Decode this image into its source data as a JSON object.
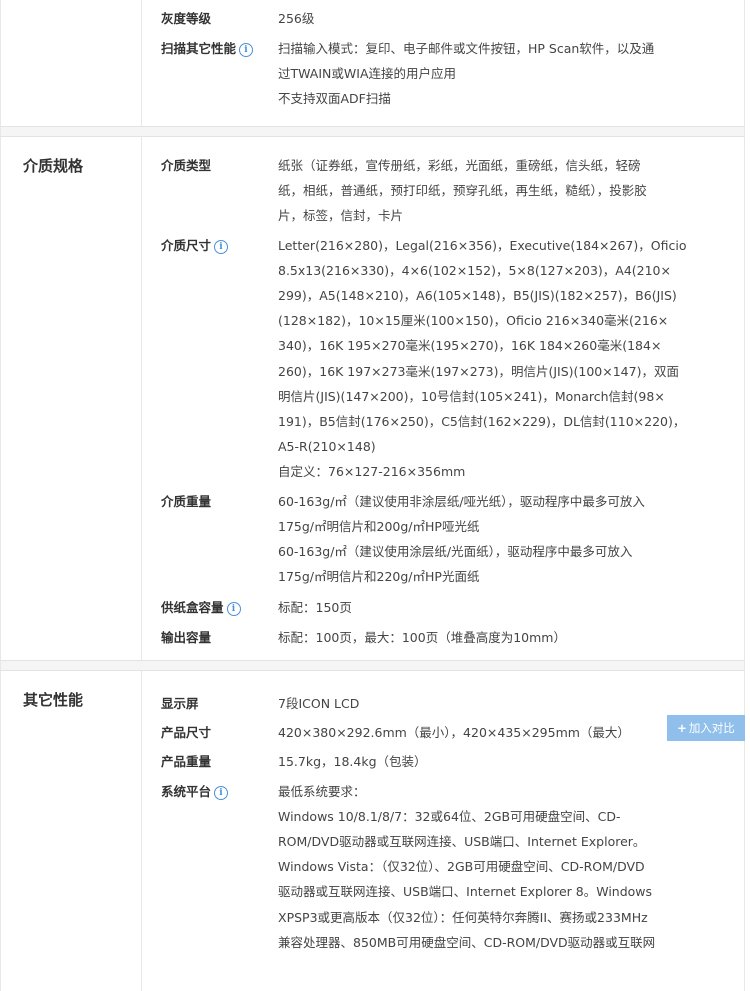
{
  "sections": [
    {
      "title": "",
      "rows": [
        {
          "label": "灰度等级",
          "info": false,
          "lines": [
            "256级"
          ]
        },
        {
          "label": "扫描其它性能",
          "info": true,
          "lines": [
            "扫描输入模式：复印、电子邮件或文件按钮，HP Scan软件，以及通",
            "过TWAIN或WIA连接的用户应用",
            "不支持双面ADF扫描"
          ]
        }
      ]
    },
    {
      "title": "介质规格",
      "rows": [
        {
          "label": "介质类型",
          "info": false,
          "lines": [
            "纸张（证券纸，宣传册纸，彩纸，光面纸，重磅纸，信头纸，轻磅",
            "纸，相纸，普通纸，预打印纸，预穿孔纸，再生纸，糙纸），投影胶",
            "片，标签，信封，卡片"
          ]
        },
        {
          "label": "介质尺寸",
          "info": true,
          "lines": [
            "Letter(216×280)，Legal(216×356)，Executive(184×267)，Oficio",
            "8.5x13(216×330)，4×6(102×152)，5×8(127×203)，A4(210×",
            "299)，A5(148×210)，A6(105×148)，B5(JIS)(182×257)，B6(JIS)",
            "(128×182)，10×15厘米(100×150)，Oficio 216×340毫米(216×",
            "340)，16K 195×270毫米(195×270)，16K 184×260毫米(184×",
            "260)，16K 197×273毫米(197×273)，明信片(JIS)(100×147)，双面",
            "明信片(JIS)(147×200)，10号信封(105×241)，Monarch信封(98×",
            "191)，B5信封(176×250)，C5信封(162×229)，DL信封(110×220)，",
            "A5-R(210×148)",
            "自定义：76×127-216×356mm"
          ]
        },
        {
          "label": "介质重量",
          "info": false,
          "lines": [
            "60-163g/㎡（建议使用非涂层纸/哑光纸），驱动程序中最多可放入",
            "175g/㎡明信片和200g/㎡HP哑光纸",
            "60-163g/㎡（建议使用涂层纸/光面纸），驱动程序中最多可放入",
            "175g/㎡明信片和220g/㎡HP光面纸"
          ]
        },
        {
          "label": "供纸盒容量",
          "info": true,
          "lines": [
            "标配：150页"
          ]
        },
        {
          "label": "输出容量",
          "info": false,
          "lines": [
            "标配：100页，最大：100页（堆叠高度为10mm）"
          ]
        }
      ]
    },
    {
      "title": "其它性能",
      "rows": [
        {
          "label": "显示屏",
          "info": false,
          "lines": [
            "7段ICON LCD"
          ]
        },
        {
          "label": "产品尺寸",
          "info": false,
          "lines": [
            "420×380×292.6mm（最小），420×435×295mm（最大）"
          ]
        },
        {
          "label": "产品重量",
          "info": false,
          "lines": [
            "15.7kg，18.4kg（包装）"
          ]
        },
        {
          "label": "系统平台",
          "info": true,
          "lines": [
            "最低系统要求：",
            "Windows 10/8.1/8/7：32或64位、2GB可用硬盘空间、CD-",
            "ROM/DVD驱动器或互联网连接、USB端口、Internet Explorer。",
            "Windows Vista：（仅32位）、2GB可用硬盘空间、CD-ROM/DVD",
            "驱动器或互联网连接、USB端口、Internet Explorer 8。Windows",
            "XPSP3或更高版本（仅32位）：任何英特尔奔腾II、赛扬或233MHz",
            "兼容处理器、850MB可用硬盘空间、CD-ROM/DVD驱动器或互联网"
          ]
        }
      ]
    }
  ],
  "compare_button": {
    "icon": "+",
    "label": "加入对比"
  }
}
